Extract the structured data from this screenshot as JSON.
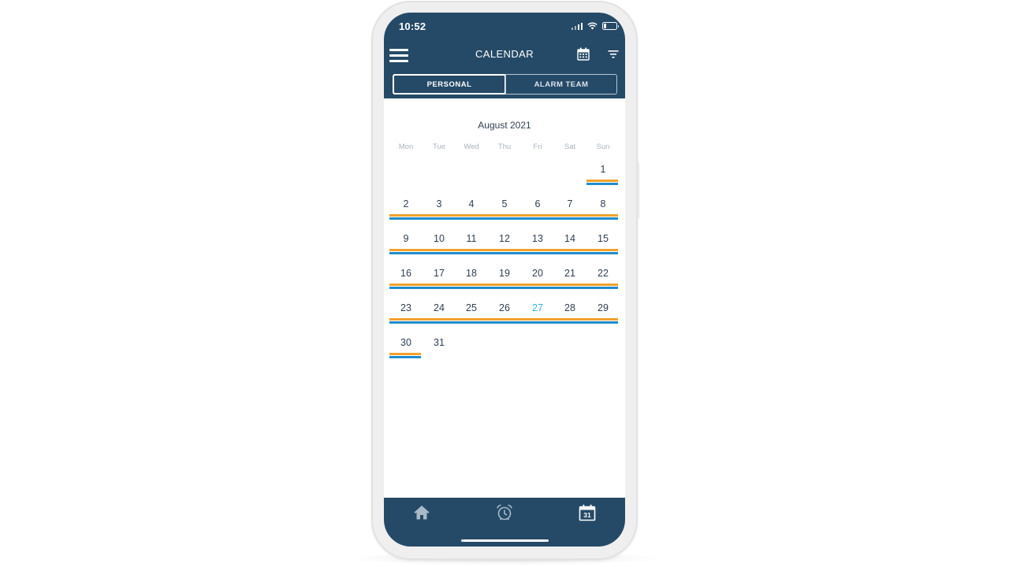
{
  "status_bar": {
    "time": "10:52"
  },
  "header": {
    "title": "CALENDAR",
    "icons": [
      "menu-icon",
      "calendar-icon",
      "filter-icon"
    ]
  },
  "tabs": [
    {
      "label": "PERSONAL",
      "active": true
    },
    {
      "label": "ALARM TEAM",
      "active": false
    }
  ],
  "calendar": {
    "month_label": "August 2021",
    "weekdays": [
      "Mon",
      "Tue",
      "Wed",
      "Thu",
      "Fri",
      "Sat",
      "Sun"
    ],
    "first_day_weekday_index": 6,
    "days": [
      "1",
      "2",
      "3",
      "4",
      "5",
      "6",
      "7",
      "8",
      "9",
      "10",
      "11",
      "12",
      "13",
      "14",
      "15",
      "16",
      "17",
      "18",
      "19",
      "20",
      "21",
      "22",
      "23",
      "24",
      "25",
      "26",
      "27",
      "28",
      "29",
      "30",
      "31"
    ],
    "today": "27",
    "event_markers_days": [
      "1",
      "2",
      "3",
      "4",
      "5",
      "6",
      "7",
      "8",
      "9",
      "10",
      "11",
      "12",
      "13",
      "14",
      "15",
      "16",
      "17",
      "18",
      "19",
      "20",
      "21",
      "22",
      "23",
      "24",
      "25",
      "26",
      "27",
      "28",
      "29",
      "30"
    ],
    "marker_colors": {
      "orange": "#f2a12a",
      "blue": "#1f8dce"
    },
    "today_color": "#2fb7d6"
  },
  "bottom_nav": {
    "items": [
      {
        "icon": "home-icon",
        "active": false
      },
      {
        "icon": "alarm-clock-icon",
        "active": false
      },
      {
        "icon": "calendar-icon",
        "label": "31",
        "active": true
      }
    ]
  },
  "colors": {
    "primary": "#254a67",
    "text": "#2e3f52",
    "muted": "#a8b3be"
  }
}
